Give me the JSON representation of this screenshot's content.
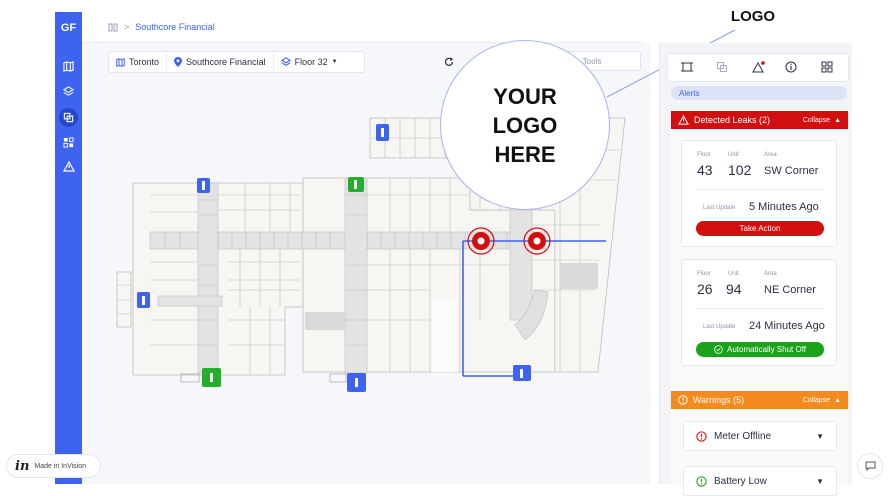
{
  "sidebar": {
    "logo": "GF",
    "items": [
      {
        "icon": "map-icon"
      },
      {
        "icon": "layers-icon"
      },
      {
        "icon": "copy-icon"
      },
      {
        "icon": "grid-icon"
      },
      {
        "icon": "warning-icon"
      }
    ]
  },
  "breadcrumb": {
    "current": "Southcore Financial",
    "separator": ">"
  },
  "toolbar": {
    "city": "Toronto",
    "building": "Southcore Financial",
    "floor": "Floor 32",
    "tools_label": "ilable Tools"
  },
  "logo_overlay": {
    "label_top": "LOGO",
    "line1": "YOUR",
    "line2": "LOGO",
    "line3": "HERE"
  },
  "panel": {
    "alerts_tab": "Alerts",
    "detected": {
      "title": "Detected Leaks (2)",
      "collapse": "Collapse",
      "labels": {
        "floor": "Floor",
        "unit": "Unit",
        "area": "Area",
        "last_update": "Last Update"
      },
      "leaks": [
        {
          "floor": "43",
          "unit": "102",
          "area": "SW Corner",
          "last_update": "5 Minutes Ago",
          "action": "Take Action"
        },
        {
          "floor": "26",
          "unit": "94",
          "area": "NE Corner",
          "last_update": "24 Minutes Ago",
          "action": "Automatically Shut Off"
        }
      ]
    },
    "warnings": {
      "title": "Warnings (5)",
      "collapse": "Collapse",
      "items": [
        {
          "label": "Meter Offline"
        },
        {
          "label": "Battery Low"
        }
      ]
    }
  },
  "invision": {
    "mark": "in",
    "label": "Made in InVision"
  },
  "colors": {
    "brand_blue": "#3d63f0",
    "alert_red": "#d10f0f",
    "warning_orange": "#f58a1f",
    "ok_green": "#1aa31a",
    "door_green": "#22b02c"
  }
}
